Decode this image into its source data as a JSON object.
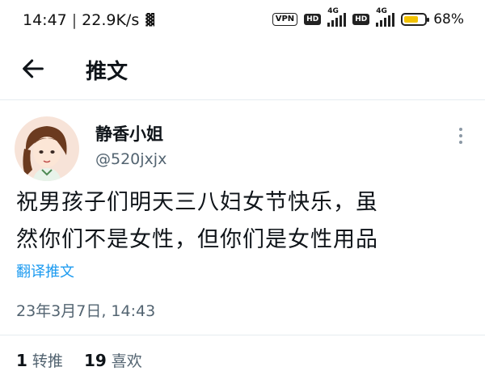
{
  "status_bar": {
    "time": "14:47",
    "separator": "|",
    "net_speed": "22.9K/s",
    "vpn_label": "VPN",
    "hd_label_1": "HD",
    "hd_label_2": "HD",
    "signal_tag_1": "4G",
    "signal_tag_2": "4G",
    "battery_percent": "68%",
    "battery_level": 0.68,
    "battery_color": "#f2c200"
  },
  "header": {
    "title": "推文",
    "back_icon": "arrow-left-icon"
  },
  "tweet": {
    "display_name": "静香小姐",
    "handle": "@520jxjx",
    "text_line_1": "祝男孩子们明天三八妇女节快乐，虽",
    "text_line_2": "然你们不是女性，但你们是女性用品",
    "translate_label": "翻译推文",
    "timestamp": "23年3月7日, 14:43",
    "more_icon": "more-vertical-icon"
  },
  "stats": {
    "retweets_count": "1",
    "retweets_label": "转推",
    "likes_count": "19",
    "likes_label": "喜欢"
  },
  "colors": {
    "accent": "#1d9bf0",
    "secondary_text": "#536471",
    "divider": "#e6ecf0"
  }
}
